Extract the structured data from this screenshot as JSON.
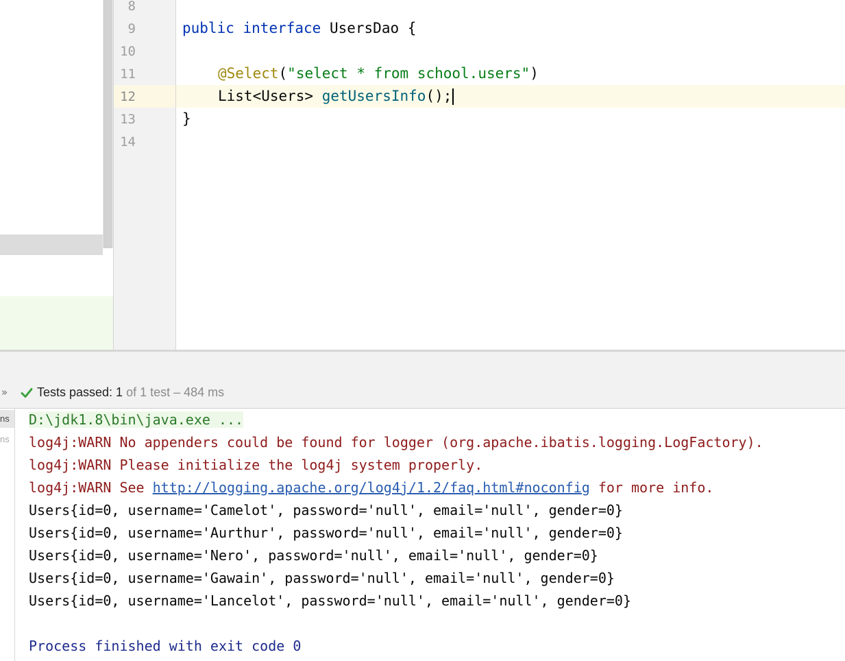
{
  "editor": {
    "line_numbers": [
      "8",
      "9",
      "10",
      "11",
      "12",
      "13",
      "14"
    ],
    "current_line": "12",
    "lines": {
      "l9": {
        "kw1": "public",
        "kw2": "interface",
        "name": " UsersDao {"
      },
      "l11": {
        "annotation": "@Select",
        "open": "(",
        "string": "\"select * from school.users\"",
        "close": ")"
      },
      "l12": {
        "type": "List<Users> ",
        "method": "getUsersInfo",
        "rest": "();"
      },
      "l13": {
        "text": "}"
      }
    }
  },
  "test_results": {
    "chevron": "»",
    "passed_label": "Tests passed: 1",
    "detail": " of 1 test – 484 ms",
    "icon": "check-icon",
    "tree_items": [
      "ns",
      "ns"
    ]
  },
  "console": {
    "command": "D:\\jdk1.8\\bin\\java.exe ...",
    "warn1": "log4j:WARN No appenders could be found for logger (org.apache.ibatis.logging.LogFactory).",
    "warn2": "log4j:WARN Please initialize the log4j system properly.",
    "warn3_prefix": "log4j:WARN See ",
    "warn3_link": "http://logging.apache.org/log4j/1.2/faq.html#noconfig",
    "warn3_suffix": " for more info.",
    "output": [
      "Users{id=0, username='Camelot', password='null', email='null', gender=0}",
      "Users{id=0, username='Aurthur', password='null', email='null', gender=0}",
      "Users{id=0, username='Nero', password='null', email='null', gender=0}",
      "Users{id=0, username='Gawain', password='null', email='null', gender=0}",
      "Users{id=0, username='Lancelot', password='null', email='null', gender=0}"
    ],
    "exit_message": "Process finished with exit code 0"
  },
  "colors": {
    "keyword": "#0033b3",
    "annotation": "#9e880d",
    "string": "#067d17",
    "method": "#00627a",
    "warn": "#8f1b1b",
    "link": "#2a5db0",
    "system": "#1d2b8c",
    "success": "#3ea33e"
  }
}
